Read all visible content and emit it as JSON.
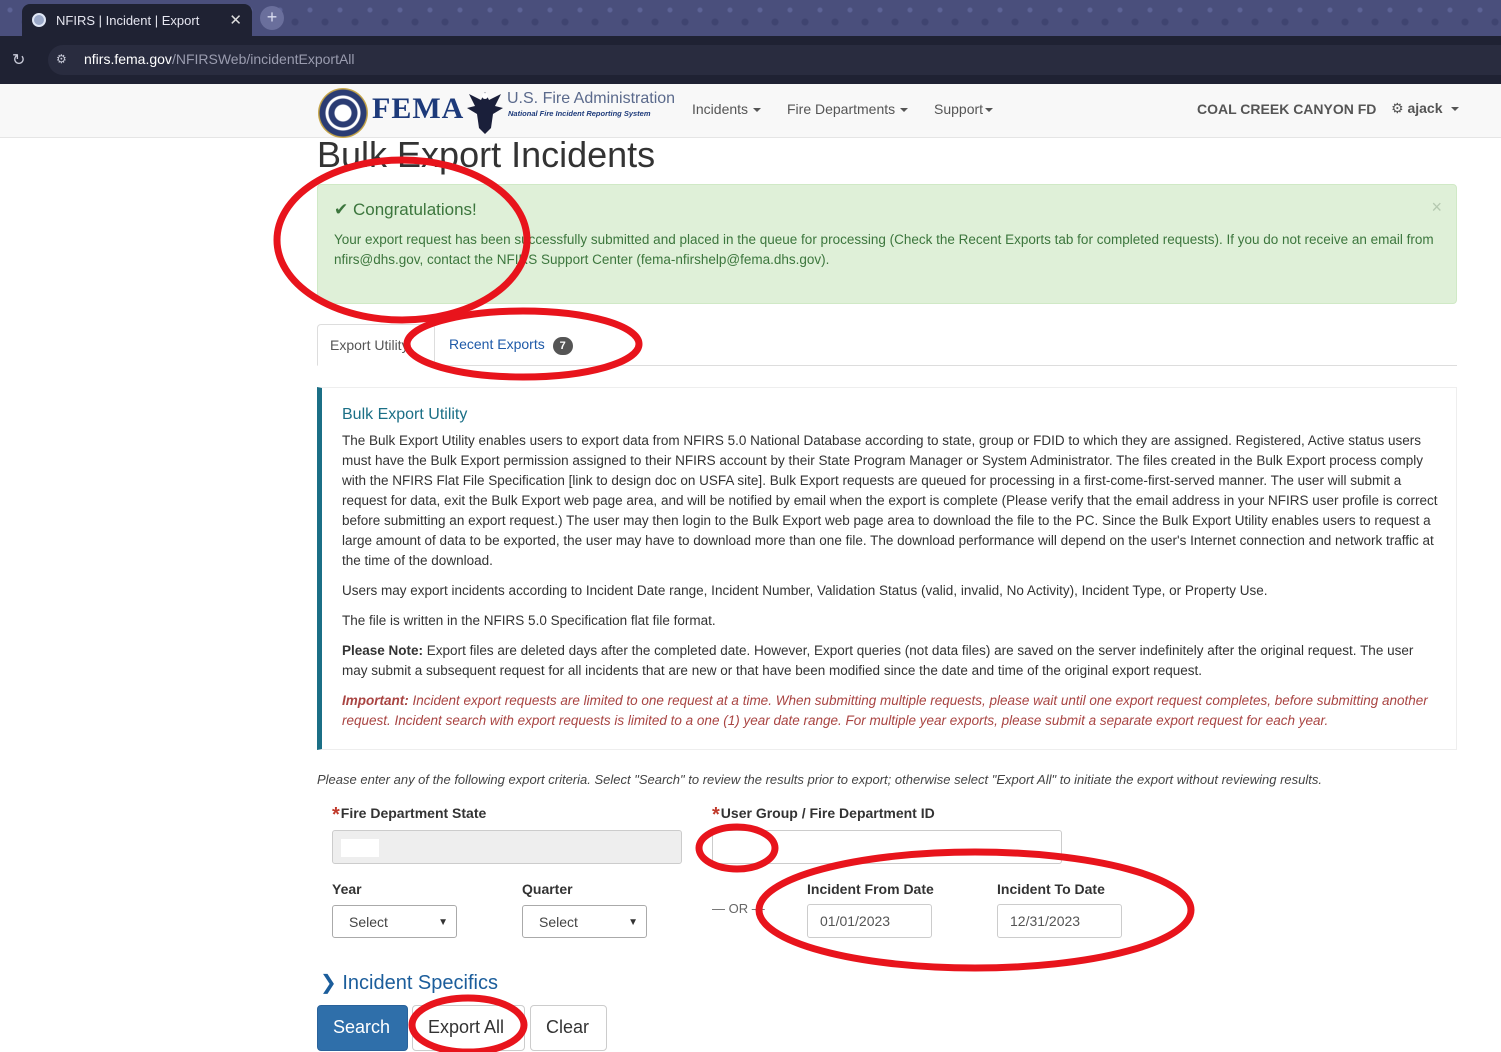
{
  "browser": {
    "tab_title": "NFIRS | Incident | Export",
    "url_host": "nfirs.fema.gov",
    "url_path": "/NFIRSWeb/incidentExportAll"
  },
  "navbar": {
    "brand": "FEMA",
    "usfa_title": "U.S. Fire Administration",
    "usfa_subtitle": "National Fire Incident Reporting System",
    "links": [
      "Incidents",
      "Fire Departments",
      "Support"
    ],
    "department": "COAL CREEK CANYON FD",
    "user": "ajack"
  },
  "page": {
    "title": "Bulk Export Incidents"
  },
  "alert": {
    "heading": "Congratulations!",
    "message": "Your export request has been successfully submitted and placed in the queue for processing (Check the Recent Exports tab for completed requests). If you do not receive an email from nfirs@dhs.gov, contact the NFIRS Support Center (fema-nfirshelp@fema.dhs.gov)."
  },
  "tabs": {
    "export_utility": "Export Utility",
    "recent_exports": "Recent Exports",
    "recent_count": "7"
  },
  "panel": {
    "heading": "Bulk Export Utility",
    "p1": "The Bulk Export Utility enables users to export data from NFIRS 5.0 National Database according to state, group or FDID to which they are assigned. Registered, Active status users must have the Bulk Export permission assigned to their NFIRS account by their State Program Manager or System Administrator. The files created in the Bulk Export process comply with the NFIRS Flat File Specification [link to design doc on USFA site]. Bulk Export requests are queued for processing in a first-come-first-served manner. The user will submit a request for data, exit the Bulk Export web page area, and will be notified by email when the export is complete (Please verify that the email address in your NFIRS user profile is correct before submitting an export request.) The user may then login to the Bulk Export web page area to download the file to the PC. Since the Bulk Export Utility enables users to request a large amount of data to be exported, the user may have to download more than one file. The download performance will depend on the user's Internet connection and network traffic at the time of the download.",
    "p2": "Users may export incidents according to Incident Date range, Incident Number, Validation Status (valid, invalid, No Activity), Incident Type, or Property Use.",
    "p3": "The file is written in the NFIRS 5.0 Specification flat file format.",
    "note_label": "Please Note:",
    "note_text": " Export files are deleted days after the completed date. However, Export queries (not data files) are saved on the server indefinitely after the original request. The user may submit a subsequent request for all incidents that are new or that have been modified since the date and time of the original export request.",
    "important_label": "Important:",
    "important_text": " Incident export requests are limited to one request at a time. When submitting multiple requests, please wait until one export request completes, before submitting another request. Incident search with export requests is limited to a one (1) year date range. For multiple year exports, please submit a separate export request for each year."
  },
  "form": {
    "criteria_text": "Please enter any of the following export criteria. Select \"Search\" to review the results prior to export; otherwise select \"Export All\" to initiate the export without reviewing results.",
    "required_mark": "*",
    "state_label": "Fire Department State",
    "group_label": "User Group / Fire Department ID",
    "year_label": "Year",
    "year_value": "Select",
    "quarter_label": "Quarter",
    "quarter_value": "Select",
    "or_text": "— OR —",
    "from_label": "Incident From Date",
    "from_value": "01/01/2023",
    "to_label": "Incident To Date",
    "to_value": "12/31/2023",
    "specifics": "Incident Specifics"
  },
  "buttons": {
    "search": "Search",
    "export_all": "Export All",
    "clear": "Clear"
  },
  "colors": {
    "annotation": "#e8141c",
    "primary": "#2f6faa",
    "alert_bg": "#dff0d8"
  }
}
